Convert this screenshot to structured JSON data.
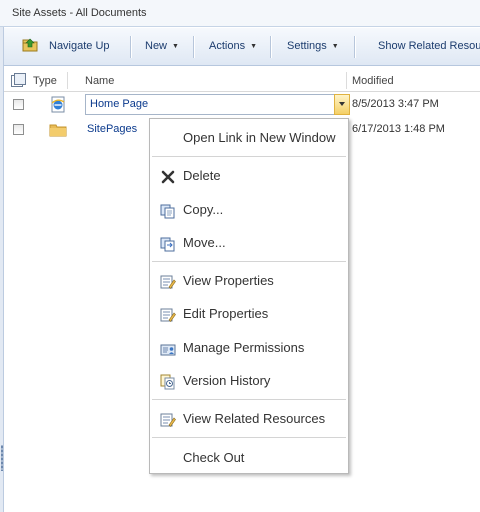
{
  "window": {
    "title": "Site Assets - All Documents"
  },
  "toolbar": {
    "navigate_up": "Navigate Up",
    "new": "New",
    "actions": "Actions",
    "settings": "Settings",
    "show_related": "Show Related Resourc"
  },
  "columns": {
    "type": "Type",
    "name": "Name",
    "modified": "Modified"
  },
  "rows": [
    {
      "name": "Home Page",
      "modified": "8/5/2013 3:47 PM",
      "icon": "ie-page-icon"
    },
    {
      "name": "SitePages",
      "modified": "6/17/2013 1:48 PM",
      "icon": "folder-icon"
    }
  ],
  "context_menu": {
    "open_new_window": "Open Link in New Window",
    "delete": "Delete",
    "copy": "Copy...",
    "move": "Move...",
    "view_properties": "View Properties",
    "edit_properties": "Edit Properties",
    "manage_permissions": "Manage Permissions",
    "version_history": "Version History",
    "view_related": "View Related Resources",
    "check_out": "Check Out"
  }
}
